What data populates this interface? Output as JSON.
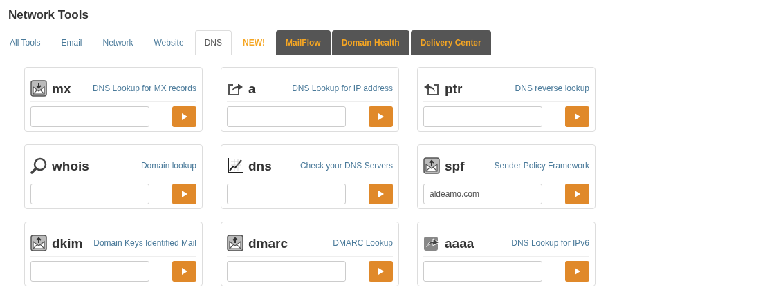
{
  "title": "Network Tools",
  "tabs": [
    {
      "label": "All Tools",
      "kind": "plain",
      "selected": false
    },
    {
      "label": "Email",
      "kind": "plain",
      "selected": false
    },
    {
      "label": "Network",
      "kind": "plain",
      "selected": false
    },
    {
      "label": "Website",
      "kind": "plain",
      "selected": false
    },
    {
      "label": "DNS",
      "kind": "plain",
      "selected": true
    },
    {
      "label": "NEW!",
      "kind": "new",
      "selected": false
    },
    {
      "label": "MailFlow",
      "kind": "dark",
      "selected": false
    },
    {
      "label": "Domain Health",
      "kind": "dark",
      "selected": false
    },
    {
      "label": "Delivery Center",
      "kind": "dark",
      "selected": false
    }
  ],
  "tools": [
    {
      "name": "mx",
      "description": "DNS Lookup for MX records"
    },
    {
      "name": "a",
      "description": "DNS Lookup for IP address"
    },
    {
      "name": "ptr",
      "description": "DNS reverse lookup"
    },
    {
      "name": "whois",
      "description": "Domain lookup"
    },
    {
      "name": "dns",
      "description": "Check your DNS Servers"
    },
    {
      "name": "spf",
      "description": "Sender Policy Framework",
      "value": "aldeamo.com"
    },
    {
      "name": "dkim",
      "description": "Domain Keys Identified Mail"
    },
    {
      "name": "dmarc",
      "description": "DMARC Lookup"
    },
    {
      "name": "aaaa",
      "description": "DNS Lookup for IPv6"
    }
  ]
}
